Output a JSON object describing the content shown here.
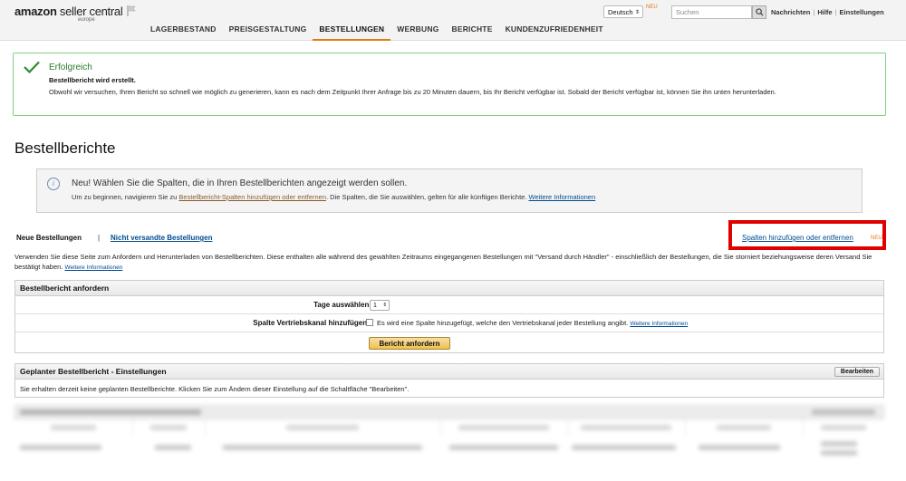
{
  "header": {
    "logo_main": "amazon",
    "logo_rest": " seller central",
    "logo_sub": "europe",
    "language": "Deutsch",
    "language_badge": "NEU",
    "search_placeholder": "Suchen",
    "links": [
      "Nachrichten",
      "Hilfe",
      "Einstellungen"
    ],
    "nav": [
      "LAGERBESTAND",
      "PREISGESTALTUNG",
      "BESTELLUNGEN",
      "WERBUNG",
      "BERICHTE",
      "KUNDENZUFRIEDENHEIT"
    ],
    "nav_active": "BESTELLUNGEN"
  },
  "success": {
    "title": "Erfolgreich",
    "bold": "Bestellbericht wird erstellt.",
    "text": "Obwohl wir versuchen, Ihren Bericht so schnell wie möglich zu generieren, kann es nach dem Zeitpunkt Ihrer Anfrage bis zu 20 Minuten dauern, bis Ihr Bericht verfügbar ist. Sobald der Bericht verfügbar ist, können Sie ihn unten herunterladen."
  },
  "page_title": "Bestellberichte",
  "info": {
    "title": "Neu! Wählen Sie die Spalten, die in Ihren Bestellberichten angezeigt werden sollen.",
    "text_before": "Um zu beginnen, navigieren Sie zu ",
    "link1": "Bestellbericht-Spalten hinzufügen oder entfernen",
    "text_middle": ". Die Spalten, die Sie auswählen, gelten für alle künftigen Berichte. ",
    "link2": "Weitere Informationen"
  },
  "tabs": {
    "tab1": "Neue Bestellungen",
    "separator": "|",
    "tab2": "Nicht versandte Bestellungen",
    "columns_link": "Spalten hinzufügen oder entfernen",
    "columns_badge": "NEU"
  },
  "description": {
    "text": "Verwenden Sie diese Seite zum Anfordern und Herunterladen von Bestellberichten. Diese enthalten alle während des gewählten Zeitraums eingegangenen Bestellungen mit \"Versand durch Händler\" - einschließlich der Bestellungen, die Sie storniert beziehungsweise deren Versand Sie bestätigt haben. ",
    "link": "Weitere Informationen"
  },
  "request_panel": {
    "title": "Bestellbericht anfordern",
    "days_label": "Tage auswählen:",
    "days_value": "1",
    "channel_label": "Spalte Vertriebskanal hinzufügen?",
    "channel_text": "Es wird eine Spalte hinzugefügt, welche den Vertriebskanal jeder Bestellung angibt. ",
    "channel_link": "Weitere Informationen",
    "button": "Bericht anfordern"
  },
  "scheduled_panel": {
    "title": "Geplanter Bestellbericht - Einstellungen",
    "edit_button": "Bearbeiten",
    "text": "Sie erhalten derzeit keine geplanten Bestellberichte. Klicken Sie zum Ändern dieser Einstellung auf die Schaltfläche \"Bearbeiten\"."
  },
  "colors": {
    "accent": "#e47911",
    "success_border": "#7fd27f",
    "highlight": "#e00000",
    "link": "#004b91"
  }
}
